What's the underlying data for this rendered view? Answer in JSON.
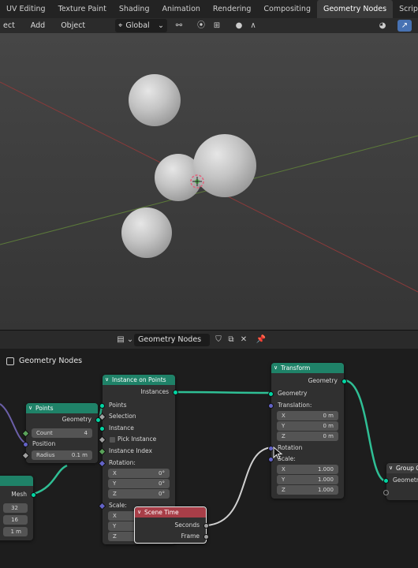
{
  "workspace_tabs": [
    "UV Editing",
    "Texture Paint",
    "Shading",
    "Animation",
    "Rendering",
    "Compositing",
    "Geometry Nodes",
    "Scripting"
  ],
  "active_tab": "Geometry Nodes",
  "viewport_header": {
    "menus": [
      "ect",
      "Add",
      "Object"
    ],
    "orientation": "Global"
  },
  "node_editor": {
    "tree_name": "Geometry Nodes",
    "breadcrumb": "Geometry Nodes"
  },
  "nodes": {
    "points": {
      "title": "Points",
      "out_geometry": "Geometry",
      "count_label": "Count",
      "count_value": "4",
      "position": "Position",
      "radius_label": "Radius",
      "radius_value": "0.1 m"
    },
    "mesh": {
      "out_mesh": "Mesh",
      "values": [
        "32",
        "16",
        "1 m"
      ]
    },
    "instance_on_points": {
      "title": "Instance on Points",
      "out_instances": "Instances",
      "points": "Points",
      "selection": "Selection",
      "instance": "Instance",
      "pick_instance": "Pick Instance",
      "instance_index": "Instance Index",
      "rotation": "Rotation:",
      "rx": "X",
      "ry": "Y",
      "rz": "Z",
      "rx_val": "0°",
      "ry_val": "0°",
      "rz_val": "0°",
      "scale": "Scale:",
      "sx": "X",
      "sy": "Y",
      "sz": "Z"
    },
    "scene_time": {
      "title": "Scene Time",
      "seconds": "Seconds",
      "frame": "Frame"
    },
    "transform": {
      "title": "Transform",
      "out_geometry": "Geometry",
      "in_geometry": "Geometry",
      "translation": "Translation:",
      "tx": "X",
      "ty": "Y",
      "tz": "Z",
      "tx_val": "0 m",
      "ty_val": "0 m",
      "tz_val": "0 m",
      "rotation": "Rotation",
      "scale": "Scale:",
      "sx": "X",
      "sy": "Y",
      "sz": "Z",
      "sx_val": "1.000",
      "sy_val": "1.000",
      "sz_val": "1.000"
    },
    "group_output": {
      "title": "Group O",
      "geometry": "Geometry"
    }
  },
  "colors": {
    "geometry_header": "#1f8268",
    "input_header": "#a83e48",
    "geometry_socket": "#00d6a3",
    "vector_socket": "#6363c7",
    "accent": "#4772b3"
  }
}
